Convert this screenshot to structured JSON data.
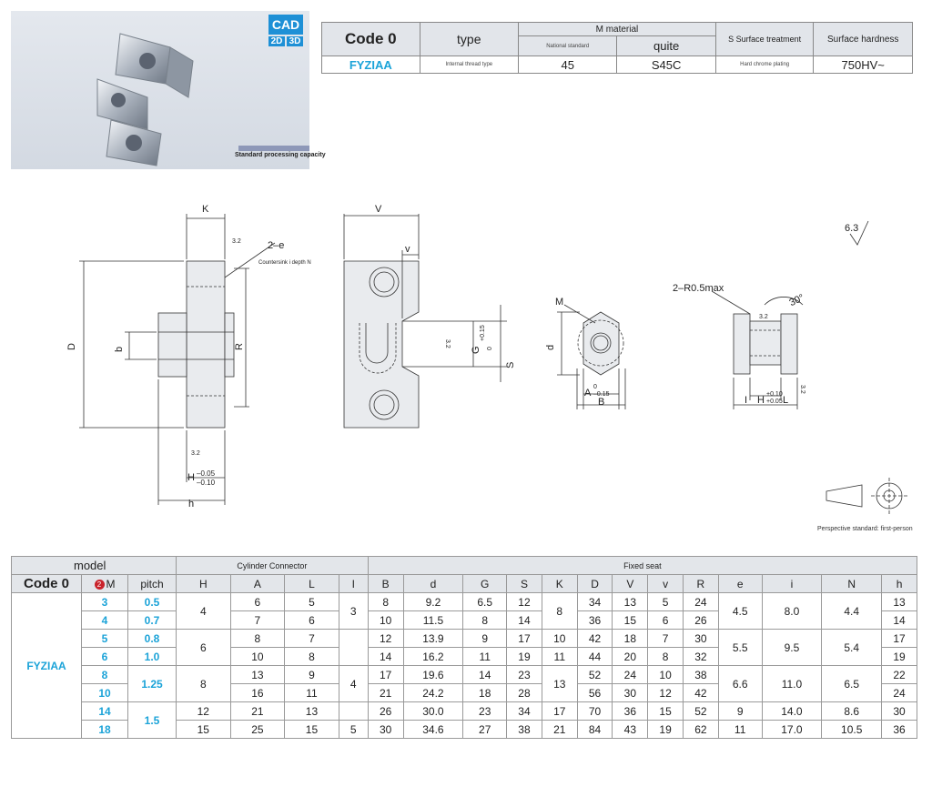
{
  "photo": {
    "cad_label": "CAD",
    "cad_2d": "2D",
    "cad_3d": "3D",
    "caption": "Standard processing capacity"
  },
  "spec": {
    "code_header": "Code 0",
    "type_header": "type",
    "material_header": "M material",
    "national_standard": "National standard",
    "quite": "quite",
    "surface_treatment_header": "S Surface treatment",
    "surface_hardness_header": "Surface hardness",
    "code_value": "FYZIAA",
    "type_value": "Internal thread type",
    "national_value": "45",
    "quite_value": "S45C",
    "treatment_value": "Hard chrome plating",
    "hardness_value": "750HV~"
  },
  "drawing": {
    "K": "K",
    "V": "V",
    "v": "v",
    "two_e": "2–e",
    "countersink": "Countersink i depth N",
    "D": "D",
    "b": "b",
    "R": "R",
    "S": "S",
    "G": "G",
    "G_tol_up": "+0.15",
    "G_tol_lo": "0",
    "roughness_32": "3.2",
    "roughness_63": "6.3",
    "H_lbl": "H",
    "H_tol_up": "–0.05",
    "H_tol_lo": "–0.10",
    "h": "h",
    "M": "M",
    "d": "d",
    "A": "A",
    "A_tol_up": "0",
    "A_tol_lo": "–0.15",
    "B": "B",
    "r05": "2–R0.5max",
    "angle30": "30°",
    "I": "I",
    "H2": "H",
    "H2_tol_up": "+0.10",
    "H2_tol_lo": "+0.05",
    "L": "L",
    "perspective": "Perspective standard: first-person"
  },
  "dims": {
    "model": "model",
    "cylinder_connector": "Cylinder Connector",
    "fixed_seat": "Fixed seat",
    "code0": "Code 0",
    "m_badge": "2",
    "m_label": "M",
    "pitch": "pitch",
    "cols": [
      "H",
      "A",
      "L",
      "I",
      "B",
      "d",
      "G",
      "S",
      "K",
      "D",
      "V",
      "v",
      "R",
      "e",
      "i",
      "N",
      "h"
    ],
    "code_value": "FYZIAA",
    "M": [
      "3",
      "4",
      "5",
      "6",
      "8",
      "10",
      "14",
      "18"
    ],
    "pitch_vals": [
      "0.5",
      "0.7",
      "0.8",
      "1.0",
      "1.25",
      "1.5"
    ],
    "H": [
      "4",
      "6",
      "8",
      "12",
      "15"
    ],
    "A": [
      "6",
      "7",
      "8",
      "10",
      "13",
      "16",
      "21",
      "25"
    ],
    "L": [
      "5",
      "6",
      "7",
      "8",
      "9",
      "11",
      "13",
      "15"
    ],
    "I": [
      "3",
      "4",
      "5"
    ],
    "B": [
      "8",
      "10",
      "12",
      "14",
      "17",
      "21",
      "26",
      "30"
    ],
    "d": [
      "9.2",
      "11.5",
      "13.9",
      "16.2",
      "19.6",
      "24.2",
      "30.0",
      "34.6"
    ],
    "G": [
      "6.5",
      "8",
      "9",
      "11",
      "14",
      "18",
      "23",
      "27"
    ],
    "S": [
      "12",
      "14",
      "17",
      "19",
      "23",
      "28",
      "34",
      "38"
    ],
    "K": [
      "8",
      "10",
      "11",
      "13",
      "17",
      "21"
    ],
    "D": [
      "34",
      "36",
      "42",
      "44",
      "52",
      "56",
      "70",
      "84"
    ],
    "V": [
      "13",
      "15",
      "18",
      "20",
      "24",
      "30",
      "36",
      "43"
    ],
    "v": [
      "5",
      "6",
      "7",
      "8",
      "10",
      "12",
      "15",
      "19"
    ],
    "R": [
      "24",
      "26",
      "30",
      "32",
      "38",
      "42",
      "52",
      "62"
    ],
    "e": [
      "4.5",
      "5.5",
      "6.6",
      "9",
      "11"
    ],
    "i": [
      "8.0",
      "9.5",
      "11.0",
      "14.0",
      "17.0"
    ],
    "N": [
      "4.4",
      "5.4",
      "6.5",
      "8.6",
      "10.5"
    ],
    "h": [
      "13",
      "14",
      "17",
      "19",
      "22",
      "24",
      "30",
      "36"
    ]
  }
}
